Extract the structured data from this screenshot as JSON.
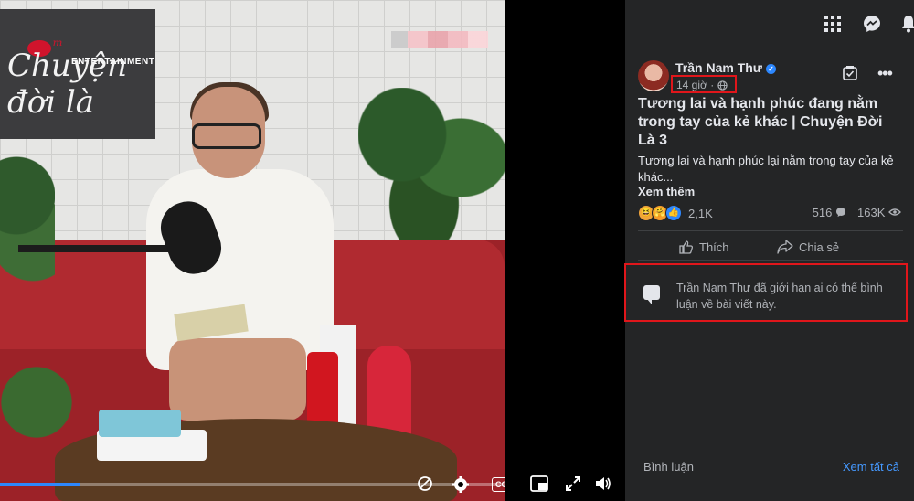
{
  "video": {
    "sign_script": "Chuyện đời là",
    "sign_brand": "ENTERTAINMENT",
    "progress": 0.16,
    "controls": [
      "captions-off-icon",
      "settings-icon",
      "cc-icon",
      "pip-icon",
      "fullscreen-icon",
      "volume-icon"
    ],
    "cc_label": "CC"
  },
  "post": {
    "author": "Trần Nam Thư",
    "verified_mark": "✓",
    "time": "14 giờ",
    "privacy_glyph": "·",
    "title": "Tương lai và hạnh phúc đang nằm trong tay của kẻ khác | Chuyện Đời Là 3",
    "description": "Tương lai và hạnh phúc lại nằm trong tay của kẻ khác...",
    "see_more": "Xem thêm",
    "reaction_count": "2,1K",
    "comment_count": "516",
    "view_count": "163K",
    "like_label": "Thích",
    "share_label": "Chia sẻ",
    "notice": "Trần Nam Thư đã giới hạn ai có thể bình luận về bài viết này.",
    "comments_label": "Bình luận",
    "see_all": "Xem tất cả"
  },
  "colors": {
    "panel_bg": "#242526",
    "accent_blue": "#2d88ff",
    "highlight_red": "#e0161b"
  }
}
